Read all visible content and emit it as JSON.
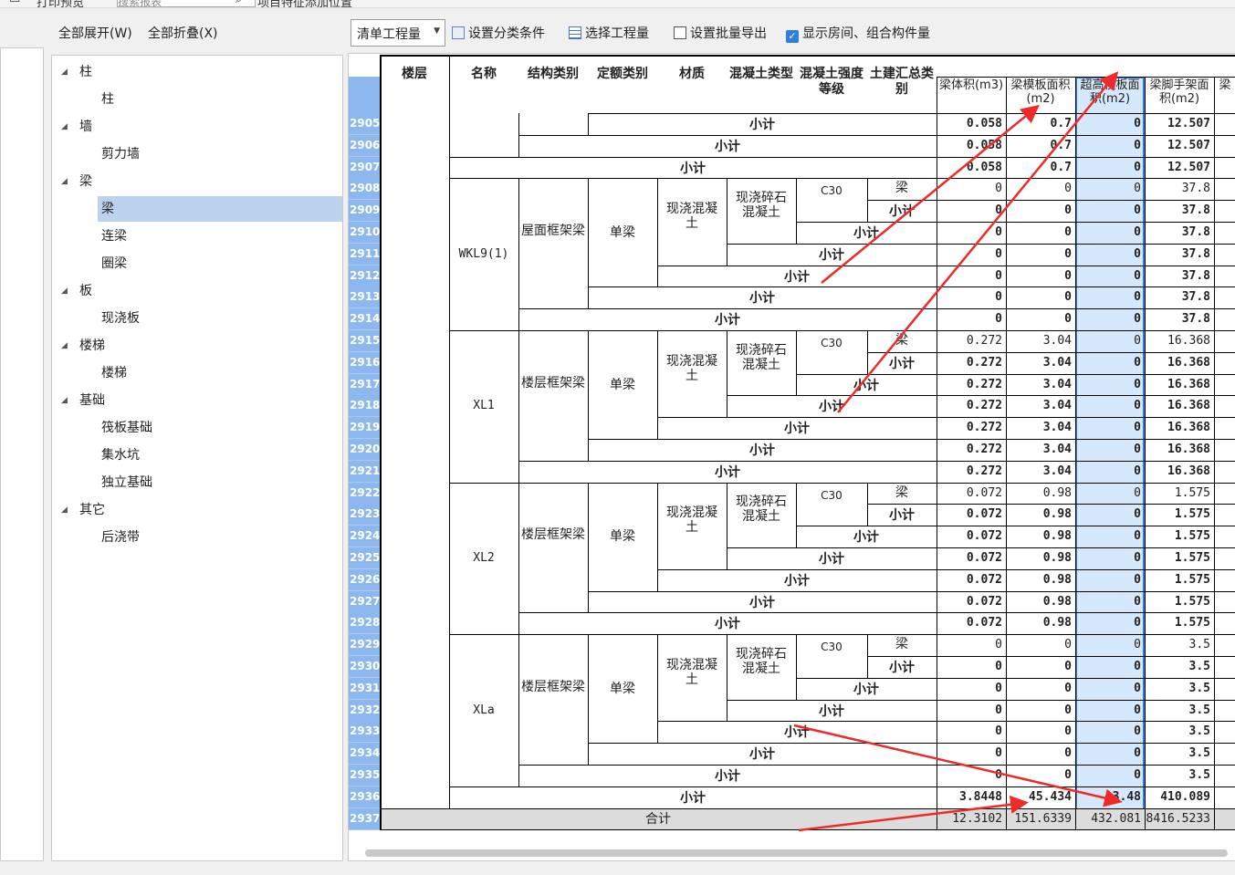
{
  "top_strip": {
    "print_preview": "打印预览",
    "search_placeholder": "搜索报表",
    "project_settings": "项目特征添加位置"
  },
  "tree_toolbar": {
    "expand_all": "全部展开(W)",
    "collapse_all": "全部折叠(X)"
  },
  "tree": [
    {
      "label": "柱",
      "children": [
        "柱"
      ]
    },
    {
      "label": "墙",
      "children": [
        "剪力墙"
      ]
    },
    {
      "label": "梁",
      "children": [
        "梁",
        "连梁",
        "圈梁"
      ]
    },
    {
      "label": "板",
      "children": [
        "现浇板"
      ]
    },
    {
      "label": "楼梯",
      "children": [
        "楼梯"
      ]
    },
    {
      "label": "基础",
      "children": [
        "筏板基础",
        "集水坑",
        "独立基础"
      ]
    },
    {
      "label": "其它",
      "children": [
        "后浇带"
      ]
    }
  ],
  "selected_tree_item": "梁",
  "toolbar": {
    "combo_value": "清单工程量",
    "set_category": "设置分类条件",
    "select_quantity": "选择工程量",
    "set_batch_export": "设置批量导出",
    "show_rooms": "显示房间、组合构件量",
    "show_rooms_checked": true
  },
  "grid": {
    "headers": {
      "floor": "楼层",
      "name": "名称",
      "struct_type": "结构类别",
      "quota_type": "定额类别",
      "material": "材质",
      "concrete_type": "混凝土类型",
      "concrete_grade": "混凝土强度等级",
      "civil_summary": "土建汇总类别",
      "volume": "梁体积(m3)",
      "formwork": "梁模板面积(m2)",
      "high_formwork": "超高模板面积(m2)",
      "scaffold": "梁脚手架面积(m2)",
      "more": "梁"
    },
    "row_numbers": [
      "2905",
      "2906",
      "2907",
      "2908",
      "2909",
      "2910",
      "2911",
      "2912",
      "2913",
      "2914",
      "2915",
      "2916",
      "2917",
      "2918",
      "2919",
      "2920",
      "2921",
      "2922",
      "2923",
      "2924",
      "2925",
      "2926",
      "2927",
      "2928",
      "2929",
      "2930",
      "2931",
      "2932",
      "2933",
      "2934",
      "2935",
      "2936",
      "2937"
    ],
    "top_subtotal_rows": [
      {
        "label": "小计",
        "volume": "0.058",
        "formwork": "0.7",
        "high": "0",
        "scaffold": "12.507"
      },
      {
        "label": "小计",
        "volume": "0.058",
        "formwork": "0.7",
        "high": "0",
        "scaffold": "12.507"
      },
      {
        "label": "小计",
        "volume": "0.058",
        "formwork": "0.7",
        "high": "0",
        "scaffold": "12.507"
      }
    ],
    "groups": [
      {
        "name": "WKL9(1)",
        "struct_type": "屋面框架梁",
        "quota_type": "单梁",
        "material": "现浇混凝土",
        "concrete_type": "现浇碎石混凝土",
        "grade": "C30",
        "first_label": "梁",
        "subtotal_label": "小计",
        "volume": "0",
        "formwork": "0",
        "high": "0",
        "scaffold": "37.8"
      },
      {
        "name": "XL1",
        "struct_type": "楼层框架梁",
        "quota_type": "单梁",
        "material": "现浇混凝土",
        "concrete_type": "现浇碎石混凝土",
        "grade": "C30",
        "first_label": "梁",
        "subtotal_label": "小计",
        "volume": "0.272",
        "formwork": "3.04",
        "high": "0",
        "scaffold": "16.368"
      },
      {
        "name": "XL2",
        "struct_type": "楼层框架梁",
        "quota_type": "单梁",
        "material": "现浇混凝土",
        "concrete_type": "现浇碎石混凝土",
        "grade": "C30",
        "first_label": "梁",
        "subtotal_label": "小计",
        "volume": "0.072",
        "formwork": "0.98",
        "high": "0",
        "scaffold": "1.575"
      },
      {
        "name": "XLa",
        "struct_type": "楼层框架梁",
        "quota_type": "单梁",
        "material": "现浇混凝土",
        "concrete_type": "现浇碎石混凝土",
        "grade": "C30",
        "first_label": "梁",
        "subtotal_label": "小计",
        "volume": "0",
        "formwork": "0",
        "high": "0",
        "scaffold": "3.5"
      }
    ],
    "floor_subtotal": {
      "label": "小计",
      "volume": "3.8448",
      "formwork": "45.434",
      "high": "13.48",
      "scaffold": "410.089"
    },
    "grand_total": {
      "label": "合计",
      "volume": "12.3102",
      "formwork": "151.6339",
      "high": "432.081",
      "scaffold": "8416.5233"
    }
  },
  "colors": {
    "selected_column": "#d6e8fb",
    "row_number_bg": "#8db8ef",
    "tree_selection": "#bcd3ef",
    "annotation_arrows": "#ee2a2a"
  }
}
